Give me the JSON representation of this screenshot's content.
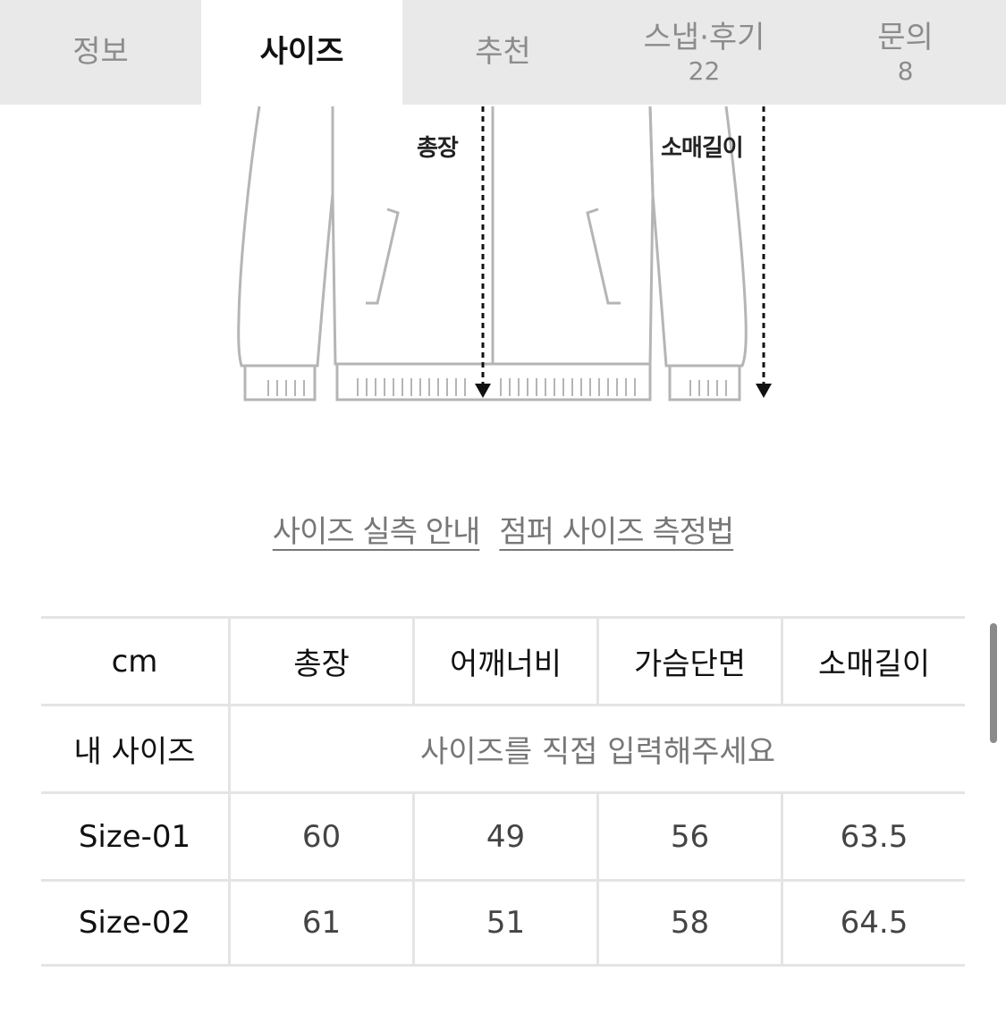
{
  "tabs": [
    {
      "label": "정보",
      "count": ""
    },
    {
      "label": "사이즈",
      "count": ""
    },
    {
      "label": "추천",
      "count": ""
    },
    {
      "label": "스냅·후기",
      "count": "22"
    },
    {
      "label": "문의",
      "count": "8"
    }
  ],
  "active_tab": "사이즈",
  "diagram": {
    "label_length": "총장",
    "label_sleeve": "소매길이"
  },
  "links": {
    "size_guide": "사이즈 실측 안내",
    "measure_method": "점퍼 사이즈 측정법"
  },
  "table": {
    "headers": [
      "cm",
      "총장",
      "어깨너비",
      "가슴단면",
      "소매길이"
    ],
    "my_size": {
      "label": "내 사이즈",
      "placeholder": "사이즈를 직접 입력해주세요"
    },
    "rows": [
      {
        "name": "Size-01",
        "values": [
          "60",
          "49",
          "56",
          "63.5"
        ]
      },
      {
        "name": "Size-02",
        "values": [
          "61",
          "51",
          "58",
          "64.5"
        ]
      }
    ]
  },
  "colors": {
    "tab_bg": "#e9e9e9",
    "active_tab_bg": "#ffffff",
    "border": "#e4e4e4",
    "muted_text": "#777777"
  }
}
